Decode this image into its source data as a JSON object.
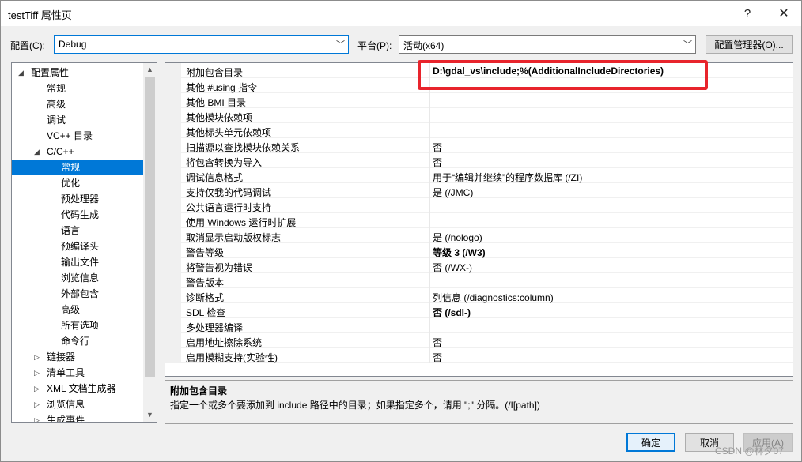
{
  "window": {
    "title": "testTiff 属性页",
    "help_label": "?",
    "close_label": "✕"
  },
  "config": {
    "label": "配置(C):",
    "value": "Debug",
    "platform_label": "平台(P):",
    "platform_value": "活动(x64)",
    "manager_button": "配置管理器(O)..."
  },
  "tree": {
    "items": [
      {
        "label": "配置属性",
        "expander": "◢",
        "level": 0
      },
      {
        "label": "常规",
        "expander": "",
        "level": 2
      },
      {
        "label": "高级",
        "expander": "",
        "level": 2
      },
      {
        "label": "调试",
        "expander": "",
        "level": 2
      },
      {
        "label": "VC++ 目录",
        "expander": "",
        "level": 2
      },
      {
        "label": "C/C++",
        "expander": "◢",
        "level": 1
      },
      {
        "label": "常规",
        "expander": "",
        "level": 3,
        "selected": true
      },
      {
        "label": "优化",
        "expander": "",
        "level": 3
      },
      {
        "label": "预处理器",
        "expander": "",
        "level": 3
      },
      {
        "label": "代码生成",
        "expander": "",
        "level": 3
      },
      {
        "label": "语言",
        "expander": "",
        "level": 3
      },
      {
        "label": "预编译头",
        "expander": "",
        "level": 3
      },
      {
        "label": "输出文件",
        "expander": "",
        "level": 3
      },
      {
        "label": "浏览信息",
        "expander": "",
        "level": 3
      },
      {
        "label": "外部包含",
        "expander": "",
        "level": 3
      },
      {
        "label": "高级",
        "expander": "",
        "level": 3
      },
      {
        "label": "所有选项",
        "expander": "",
        "level": 3
      },
      {
        "label": "命令行",
        "expander": "",
        "level": 3
      },
      {
        "label": "链接器",
        "expander": "▷",
        "level": 1
      },
      {
        "label": "清单工具",
        "expander": "▷",
        "level": 1
      },
      {
        "label": "XML 文档生成器",
        "expander": "▷",
        "level": 1
      },
      {
        "label": "浏览信息",
        "expander": "▷",
        "level": 1
      },
      {
        "label": "生成事件",
        "expander": "▷",
        "level": 1
      }
    ]
  },
  "properties": [
    {
      "name": "附加包含目录",
      "value": "D:\\gdal_vs\\include;%(AdditionalIncludeDirectories)",
      "bold": true
    },
    {
      "name": "其他 #using 指令",
      "value": ""
    },
    {
      "name": "其他 BMI 目录",
      "value": ""
    },
    {
      "name": "其他模块依赖项",
      "value": ""
    },
    {
      "name": "其他标头单元依赖项",
      "value": ""
    },
    {
      "name": "扫描源以查找模块依赖关系",
      "value": "否"
    },
    {
      "name": "将包含转换为导入",
      "value": "否"
    },
    {
      "name": "调试信息格式",
      "value": "用于“编辑并继续”的程序数据库 (/ZI)"
    },
    {
      "name": "支持仅我的代码调试",
      "value": "是 (/JMC)"
    },
    {
      "name": "公共语言运行时支持",
      "value": ""
    },
    {
      "name": "使用 Windows 运行时扩展",
      "value": ""
    },
    {
      "name": "取消显示启动版权标志",
      "value": "是 (/nologo)"
    },
    {
      "name": "警告等级",
      "value": "等级 3 (/W3)",
      "bold": true
    },
    {
      "name": "将警告视为错误",
      "value": "否 (/WX-)"
    },
    {
      "name": "警告版本",
      "value": ""
    },
    {
      "name": "诊断格式",
      "value": "列信息 (/diagnostics:column)"
    },
    {
      "name": "SDL 检查",
      "value": "否 (/sdl-)",
      "bold": true
    },
    {
      "name": "多处理器编译",
      "value": ""
    },
    {
      "name": "启用地址擦除系统",
      "value": "否"
    },
    {
      "name": "启用模糊支持(实验性)",
      "value": "否"
    }
  ],
  "description": {
    "title": "附加包含目录",
    "text": "指定一个或多个要添加到 include 路径中的目录；如果指定多个，请用 \";\" 分隔。(/I[path])"
  },
  "buttons": {
    "ok": "确定",
    "cancel": "取消",
    "apply": "应用(A)"
  },
  "watermark": "CSDN @林夕07"
}
